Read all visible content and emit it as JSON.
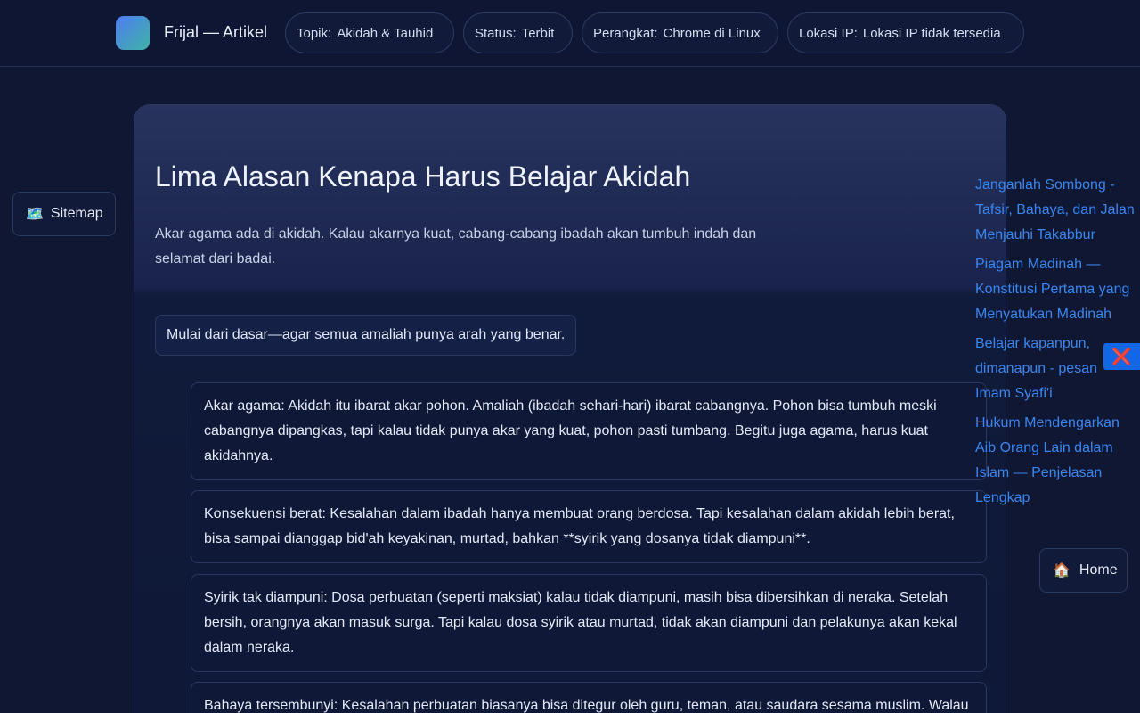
{
  "header": {
    "brand": "Frijal — Artikel",
    "chips": [
      {
        "key": "Topik:",
        "value": "Akidah & Tauhid"
      },
      {
        "key": "Status:",
        "value": "Terbit"
      },
      {
        "key": "Perangkat:",
        "value": "Chrome di Linux"
      },
      {
        "key": "Lokasi IP:",
        "value": "Lokasi IP tidak tersedia"
      }
    ]
  },
  "sitemap": {
    "icon": "map-icon",
    "glyph": "🗺️",
    "label": "Sitemap"
  },
  "article": {
    "title": "Lima Alasan Kenapa Harus Belajar Akidah",
    "lead": "Akar agama ada di akidah. Kalau akarnya kuat, cabang-cabang ibadah akan tumbuh indah dan selamat dari badai.",
    "callout": "Mulai dari dasar—agar semua amaliah punya arah yang benar.",
    "items": [
      "Akar agama: Akidah itu ibarat akar pohon. Amaliah (ibadah sehari-hari) ibarat cabangnya. Pohon bisa tumbuh meski cabangnya dipangkas, tapi kalau tidak punya akar yang kuat, pohon pasti tumbang. Begitu juga agama, harus kuat akidahnya.",
      "Konsekuensi berat: Kesalahan dalam ibadah hanya membuat orang berdosa. Tapi kesalahan dalam akidah lebih berat, bisa sampai dianggap bid'ah keyakinan, murtad, bahkan **syirik yang dosanya tidak diampuni**.",
      "Syirik tak diampuni: Dosa perbuatan (seperti maksiat) kalau tidak diampuni, masih bisa dibersihkan di neraka. Setelah bersih, orangnya akan masuk surga. Tapi kalau dosa syirik atau murtad, tidak akan diampuni dan pelakunya akan kekal dalam neraka.",
      "Bahaya tersembunyi: Kesalahan perbuatan biasanya bisa ditegur oleh guru, teman, atau saudara sesama muslim. Walau"
    ]
  },
  "related": [
    "Janganlah Sombong - Tafsir, Bahaya, dan Jalan Menjauhi Takabbur",
    "Piagam Madinah — Konstitusi Pertama yang Menyatukan Madinah",
    "Belajar kapanpun, dimanapun - pesan Imam Syafi'i",
    "Hukum Mendengarkan Aib Orang Lain dalam Islam — Penjelasan Lengkap"
  ],
  "close": {
    "icon": "close-icon",
    "glyph": "❌"
  },
  "home": {
    "icon": "home-icon",
    "glyph": "🏠",
    "label": "Home"
  }
}
